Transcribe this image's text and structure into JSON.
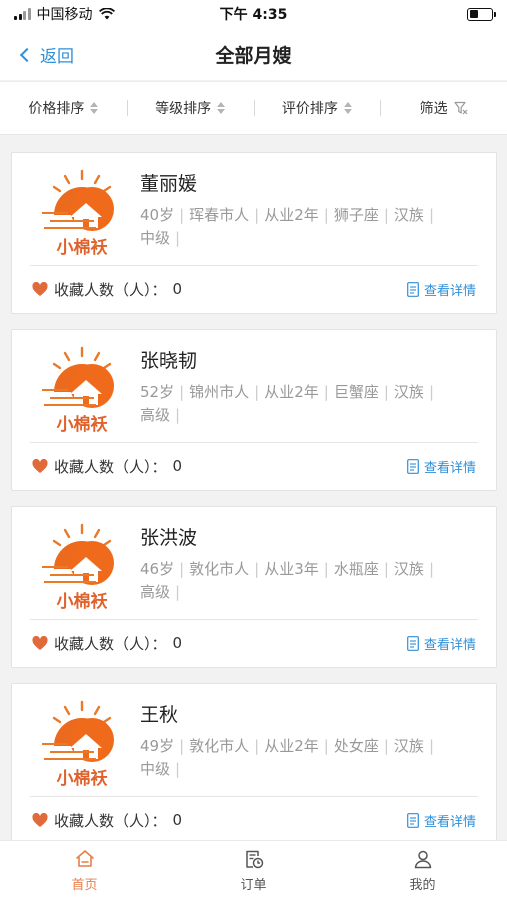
{
  "status": {
    "carrier": "中国移动",
    "time": "下午 4:35"
  },
  "nav": {
    "back_label": "返回",
    "title": "全部月嫂"
  },
  "sort": [
    {
      "label": "价格排序",
      "icon": "sort-arrows-icon"
    },
    {
      "label": "等级排序",
      "icon": "sort-arrows-icon"
    },
    {
      "label": "评价排序",
      "icon": "sort-arrows-icon"
    },
    {
      "label": "筛选",
      "icon": "filter-icon"
    }
  ],
  "brand": {
    "logo_text": "小棉袄",
    "color": "#e87a2a"
  },
  "fav_label": "收藏人数（人）：",
  "detail_label": "查看详情",
  "nannies": [
    {
      "name": "董丽媛",
      "age": "40岁",
      "hometown": "珲春市人",
      "experience": "从业2年",
      "zodiac": "狮子座",
      "ethnicity": "汉族",
      "level": "中级",
      "favorites": "0"
    },
    {
      "name": "张晓韧",
      "age": "52岁",
      "hometown": "锦州市人",
      "experience": "从业2年",
      "zodiac": "巨蟹座",
      "ethnicity": "汉族",
      "level": "高级",
      "favorites": "0"
    },
    {
      "name": "张洪波",
      "age": "46岁",
      "hometown": "敦化市人",
      "experience": "从业3年",
      "zodiac": "水瓶座",
      "ethnicity": "汉族",
      "level": "高级",
      "favorites": "0"
    },
    {
      "name": "王秋",
      "age": "49岁",
      "hometown": "敦化市人",
      "experience": "从业2年",
      "zodiac": "处女座",
      "ethnicity": "汉族",
      "level": "中级",
      "favorites": "0"
    }
  ],
  "tabs": [
    {
      "label": "首页",
      "icon": "home-icon",
      "active": true
    },
    {
      "label": "订单",
      "icon": "order-icon",
      "active": false
    },
    {
      "label": "我的",
      "icon": "user-icon",
      "active": false
    }
  ],
  "colors": {
    "accent_blue": "#2f8fd8",
    "accent_orange": "#e67e4b",
    "heart": "#e06a3a"
  }
}
